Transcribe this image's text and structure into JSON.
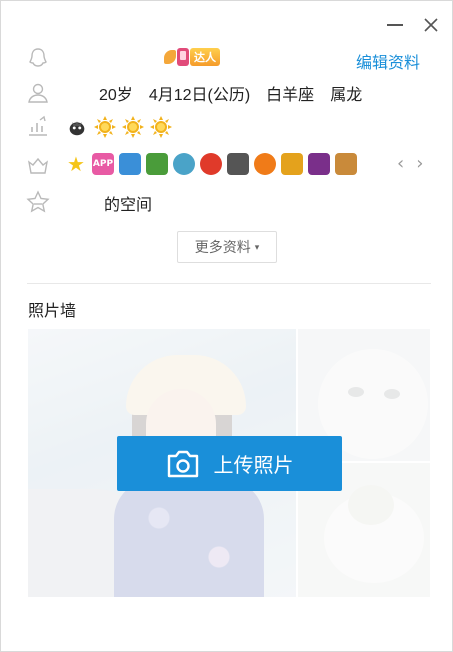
{
  "window": {
    "minimize_icon": "minimize-icon",
    "close_icon": "close-icon"
  },
  "header": {
    "talent_badge_label": "达人",
    "edit_profile_label": "编辑资料"
  },
  "profile": {
    "age": "20岁",
    "birthday": "4月12日(公历)",
    "zodiac": "白羊座",
    "chinese_zodiac": "属龙",
    "space_label": "的空间"
  },
  "level": {
    "icons": [
      "penguin-crown-icon",
      "sun-icon",
      "sun-icon",
      "sun-icon"
    ]
  },
  "services": {
    "icons": [
      {
        "name": "star-icon",
        "text": "",
        "color": "#f5c518"
      },
      {
        "name": "app-icon",
        "text": "APP",
        "color": "#e85aa4"
      },
      {
        "name": "photo-icon",
        "text": "",
        "color": "#3a8fd8"
      },
      {
        "name": "gift-icon",
        "text": "",
        "color": "#4a9c3a"
      },
      {
        "name": "eyeball-icon",
        "text": "",
        "color": "#4aa3c8"
      },
      {
        "name": "badge-2-icon",
        "text": "",
        "color": "#e03a2a"
      },
      {
        "name": "cow-icon",
        "text": "",
        "color": "#555555"
      },
      {
        "name": "music-icon",
        "text": "",
        "color": "#f07b18"
      },
      {
        "name": "coin-icon",
        "text": "",
        "color": "#e4a21c"
      },
      {
        "name": "sparkle-icon",
        "text": "",
        "color": "#7a2f8a"
      },
      {
        "name": "pet-icon",
        "text": "",
        "color": "#c98a3a"
      }
    ],
    "prev_label": "‹",
    "next_label": "›"
  },
  "more_button": {
    "label": "更多资料",
    "caret": "▾"
  },
  "photo_wall": {
    "title": "照片墙",
    "upload_label": "上传照片"
  },
  "colors": {
    "accent": "#1a8fd9",
    "divider": "#e8e8e8",
    "icon_gray": "#b9b9b9"
  }
}
